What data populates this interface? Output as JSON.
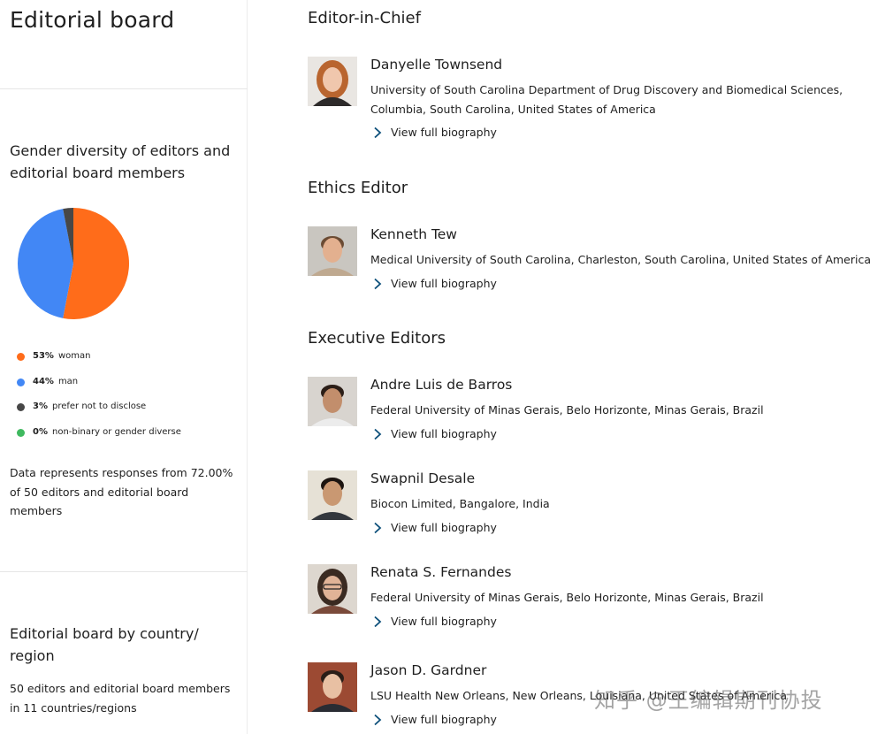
{
  "sidebar": {
    "title": "Editorial board",
    "gender_title": "Gender diversity of editors and editorial board members",
    "legend": [
      {
        "pct": "53%",
        "label": "woman",
        "color": "#ff6c1a"
      },
      {
        "pct": "44%",
        "label": "man",
        "color": "#4287f5"
      },
      {
        "pct": "3%",
        "label": "prefer not to disclose",
        "color": "#474747"
      },
      {
        "pct": "0%",
        "label": "non-binary or gender diverse",
        "color": "#3fb95f"
      }
    ],
    "note": "Data represents responses from 72.00% of 50 editors and editorial board members",
    "country_title": "Editorial board by country/ region",
    "country_note": "50 editors and editorial board members in 11 countries/regions"
  },
  "chart_data": {
    "type": "pie",
    "categories": [
      "woman",
      "man",
      "prefer not to disclose",
      "non-binary or gender diverse"
    ],
    "values": [
      53,
      44,
      3,
      0
    ],
    "colors": [
      "#ff6c1a",
      "#4287f5",
      "#474747",
      "#3fb95f"
    ]
  },
  "main": {
    "sections": [
      {
        "heading": "Editor-in-Chief",
        "people": [
          {
            "name": "Danyelle Townsend",
            "affiliation": "University of South Carolina Department of Drug Discovery and Biomedical Sciences, Columbia, South Carolina, United States of America",
            "bio_label": "View full biography"
          }
        ]
      },
      {
        "heading": "Ethics Editor",
        "people": [
          {
            "name": "Kenneth Tew",
            "affiliation": "Medical University of South Carolina, Charleston, South Carolina, United States of America",
            "bio_label": "View full biography"
          }
        ]
      },
      {
        "heading": "Executive Editors",
        "people": [
          {
            "name": "Andre Luis de Barros",
            "affiliation": "Federal University of Minas Gerais, Belo Horizonte, Minas Gerais, Brazil",
            "bio_label": "View full biography"
          },
          {
            "name": "Swapnil Desale",
            "affiliation": "Biocon Limited, Bangalore, India",
            "bio_label": "View full biography"
          },
          {
            "name": "Renata S. Fernandes",
            "affiliation": "Federal University of Minas Gerais, Belo Horizonte, Minas Gerais, Brazil",
            "bio_label": "View full biography"
          },
          {
            "name": "Jason D. Gardner",
            "affiliation": "LSU Health New Orleans, New Orleans, Louisiana, United States of America",
            "bio_label": "View full biography"
          }
        ]
      }
    ]
  },
  "watermark": "知乎 @王编辑期刊协投",
  "icons": {
    "chevron": "chevron-right-icon",
    "avatar": "person-photo"
  }
}
